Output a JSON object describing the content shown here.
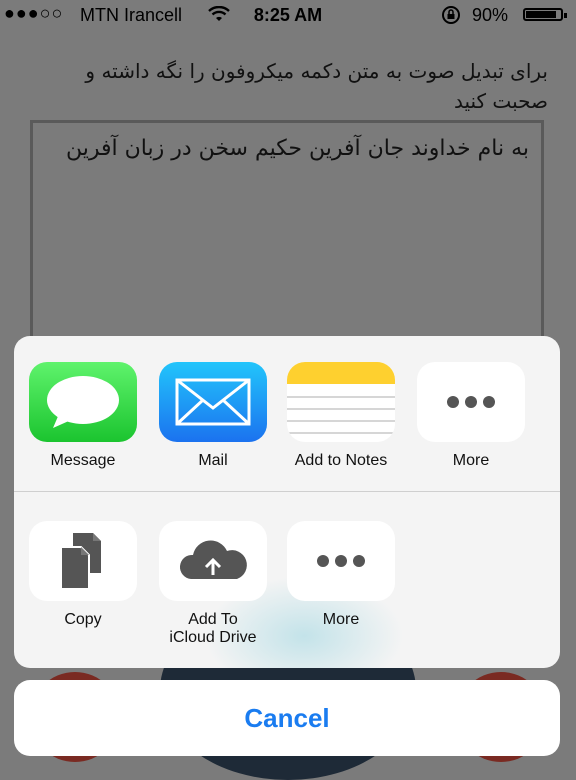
{
  "status_bar": {
    "signal": "●●●○○",
    "carrier": "MTN Irancell",
    "time": "8:25 AM",
    "battery_percent": "90%",
    "icons": [
      "signal-dots-icon",
      "wifi-icon",
      "rotation-lock-icon",
      "battery-icon"
    ]
  },
  "instruction": "برای تبدیل صوت به متن دکمه میکروفون را نگه داشته و صحبت کنید",
  "transcript": "به نام خداوند جان آفرین حکیم سخن در زبان آفرین",
  "share_sheet": {
    "apps": [
      {
        "label": "Message",
        "icon": "message-bubble-icon"
      },
      {
        "label": "Mail",
        "icon": "envelope-icon"
      },
      {
        "label": "Add to Notes",
        "icon": "notes-icon"
      },
      {
        "label": "More",
        "icon": "more-dots-icon"
      }
    ],
    "actions": [
      {
        "label": "Copy",
        "icon": "copy-documents-icon"
      },
      {
        "label": "Add To\niCloud Drive",
        "icon": "cloud-upload-icon"
      },
      {
        "label": "More",
        "icon": "more-dots-icon"
      }
    ]
  },
  "cancel_label": "Cancel",
  "colors": {
    "accent_blue": "#1a7cf0",
    "message_green": "#1bc42f",
    "mail_blue": "#1b72ef",
    "notes_yellow": "#fed02f",
    "dim_background": "#7b7b7b"
  }
}
